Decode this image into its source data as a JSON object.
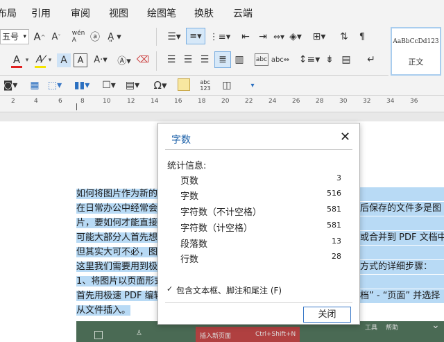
{
  "menubar": {
    "tabs": [
      "布局",
      "引用",
      "审阅",
      "视图",
      "绘图笔",
      "换肤",
      "云端"
    ]
  },
  "ribbon": {
    "font_size": "五号",
    "style_sample": "AaBbCcDd123",
    "style_name": "正文"
  },
  "ruler": {
    "numbers": [
      "2",
      "4",
      "6",
      "8",
      "10",
      "12",
      "14",
      "16",
      "18",
      "20",
      "22",
      "24",
      "26",
      "28",
      "30",
      "32",
      "34",
      "36"
    ]
  },
  "document": {
    "lines": [
      {
        "left": "如何将图片作为新的",
        "right": ""
      },
      {
        "left": "在日常办公中经常会",
        "right": "后保存的文件多是图"
      },
      {
        "left": "片，要如何才能直接",
        "right": ""
      },
      {
        "left": "可能大部分人首先想",
        "right": "或合并到 PDF 文档中，"
      },
      {
        "left": "但其实大可不必，图",
        "right": ""
      },
      {
        "left": "这里我们需要用到极",
        "right": "方式的详细步骤："
      },
      {
        "left": "1、将图片以页面形式",
        "right": ""
      },
      {
        "left": "首先用极速 PDF 编辑",
        "right": "档” - “页面” 并选择"
      },
      {
        "left": "从文件插入。",
        "right": ""
      }
    ]
  },
  "strip": {
    "items": [
      "插入新页面",
      "Ctrl+Shift+N",
      "工具",
      "帮助"
    ]
  },
  "dialog": {
    "title": "字数",
    "close_icon": "close-icon",
    "stats_heading": "统计信息:",
    "stats": [
      {
        "label": "页数",
        "value": "3"
      },
      {
        "label": "字数",
        "value": "516"
      },
      {
        "label": "字符数（不计空格）",
        "value": "581"
      },
      {
        "label": "字符数（计空格）",
        "value": "581"
      },
      {
        "label": "段落数",
        "value": "13"
      },
      {
        "label": "行数",
        "value": "28"
      }
    ],
    "checkbox_label": "包含文本框、脚注和尾注",
    "checkbox_shortcut": "(F)",
    "checkbox_checked": true,
    "close_button": "关闭"
  },
  "colors": {
    "accent": "#1a5fa8",
    "selection": "#b8daf5",
    "font_color": "#e02020",
    "highlight_color": "#f5e400"
  }
}
